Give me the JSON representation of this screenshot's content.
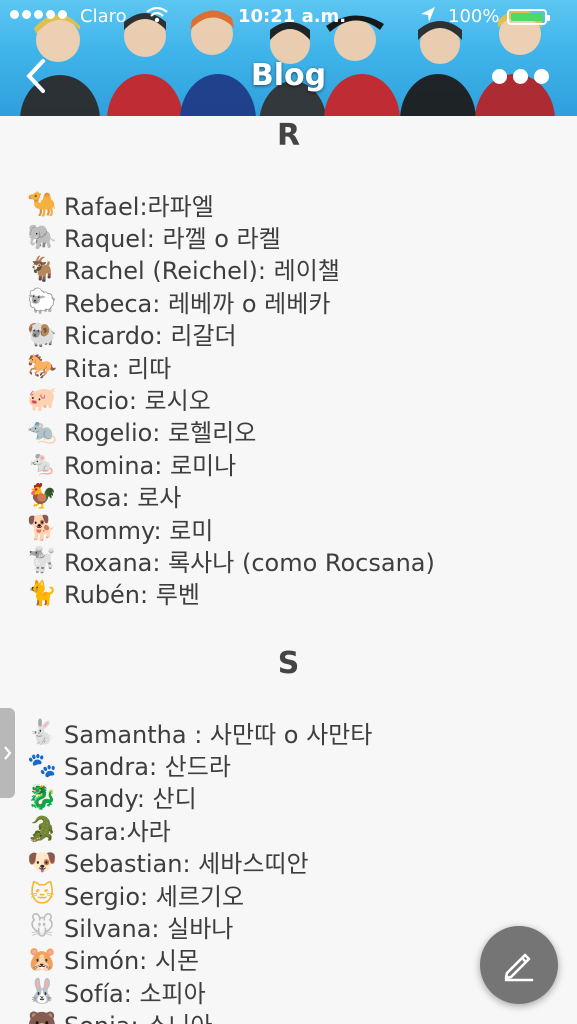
{
  "status_bar": {
    "carrier": "Claro",
    "time": "10:21 a.m.",
    "battery": "100%",
    "battery_level": 1.0
  },
  "header": {
    "title": "Blog",
    "back_icon": "chevron-left-icon",
    "more_icon": "more-dots-icon"
  },
  "sections": [
    {
      "letter": "R",
      "entries": [
        {
          "icon": "camel-emoji",
          "glyph": "🐪",
          "color": "#b07a3c",
          "text": "Rafael:라파엘"
        },
        {
          "icon": "elephant-emoji",
          "glyph": "🐘",
          "color": "#7c7c8c",
          "text": "Raquel: 라껠 o 라켈"
        },
        {
          "icon": "goat-emoji",
          "glyph": "🐐",
          "color": "#c9c9b8",
          "text": "Rachel (Reichel): 레이챌"
        },
        {
          "icon": "sheep-emoji",
          "glyph": "🐑",
          "color": "#d9d2bd",
          "text": "Rebeca: 레베까 o 레베카"
        },
        {
          "icon": "ram-emoji",
          "glyph": "🐏",
          "color": "#a08a6a",
          "text": "Ricardo: 리갈더"
        },
        {
          "icon": "horse-racing-emoji",
          "glyph": "🐎",
          "color": "#6b3a1e",
          "text": "Rita: 리따"
        },
        {
          "icon": "pig-emoji",
          "glyph": "🐖",
          "color": "#e9a3a8",
          "text": "Rocio: 로시오"
        },
        {
          "icon": "rat-emoji",
          "glyph": "🐀",
          "color": "#6f6f6f",
          "text": "Rogelio: 로헬리오"
        },
        {
          "icon": "mouse-emoji",
          "glyph": "🐁",
          "color": "#c8c8c8",
          "text": "Romina: 로미나"
        },
        {
          "icon": "rooster-emoji",
          "glyph": "🐓",
          "color": "#e0e0e0",
          "text": "Rosa: 로사"
        },
        {
          "icon": "dog-emoji",
          "glyph": "🐕",
          "color": "#d6a55c",
          "text": "Rommy: 로미"
        },
        {
          "icon": "poodle-emoji",
          "glyph": "🐩",
          "color": "#b9b9b9",
          "text": "Roxana: 록사나 (como Rocsana)"
        },
        {
          "icon": "cat-emoji",
          "glyph": "🐈",
          "color": "#e2b77a",
          "text": "Rubén: 루벤"
        }
      ]
    },
    {
      "letter": "S",
      "entries": [
        {
          "icon": "rabbit-emoji",
          "glyph": "🐇",
          "color": "#d8d8d8",
          "text": "Samantha : 사만따 o 사만타"
        },
        {
          "icon": "paw-prints-emoji",
          "glyph": "🐾",
          "color": "#d62b2b",
          "text": "Sandra: 산드라"
        },
        {
          "icon": "dragon-emoji",
          "glyph": "🐉",
          "color": "#2f8a4a",
          "text": "Sandy: 산디"
        },
        {
          "icon": "crocodile-emoji",
          "glyph": "🐊",
          "color": "#3f9a4f",
          "text": "Sara:사라"
        },
        {
          "icon": "dog-face-emoji",
          "glyph": "🐶",
          "color": "#d6a55c",
          "text": "Sebastian: 세바스띠안"
        },
        {
          "icon": "cat-face-emoji",
          "glyph": "🐱",
          "color": "#f0b93a",
          "text": "Sergio: 세르기오"
        },
        {
          "icon": "mouse-face-emoji",
          "glyph": "🐭",
          "color": "#bdbdbd",
          "text": "Silvana: 실바나"
        },
        {
          "icon": "hamster-face-emoji",
          "glyph": "🐹",
          "color": "#e8a35a",
          "text": "Simón: 시몬"
        },
        {
          "icon": "rabbit-face-emoji",
          "glyph": "🐰",
          "color": "#9c9c9c",
          "text": "Sofía: 소피아"
        },
        {
          "icon": "bear-face-emoji",
          "glyph": "🐻",
          "color": "#9a6a3a",
          "text": "Sonia: 소니아"
        }
      ]
    }
  ],
  "fab": {
    "icon": "pencil-edit-icon"
  },
  "side_tab": {
    "icon": "chevron-right-icon"
  }
}
